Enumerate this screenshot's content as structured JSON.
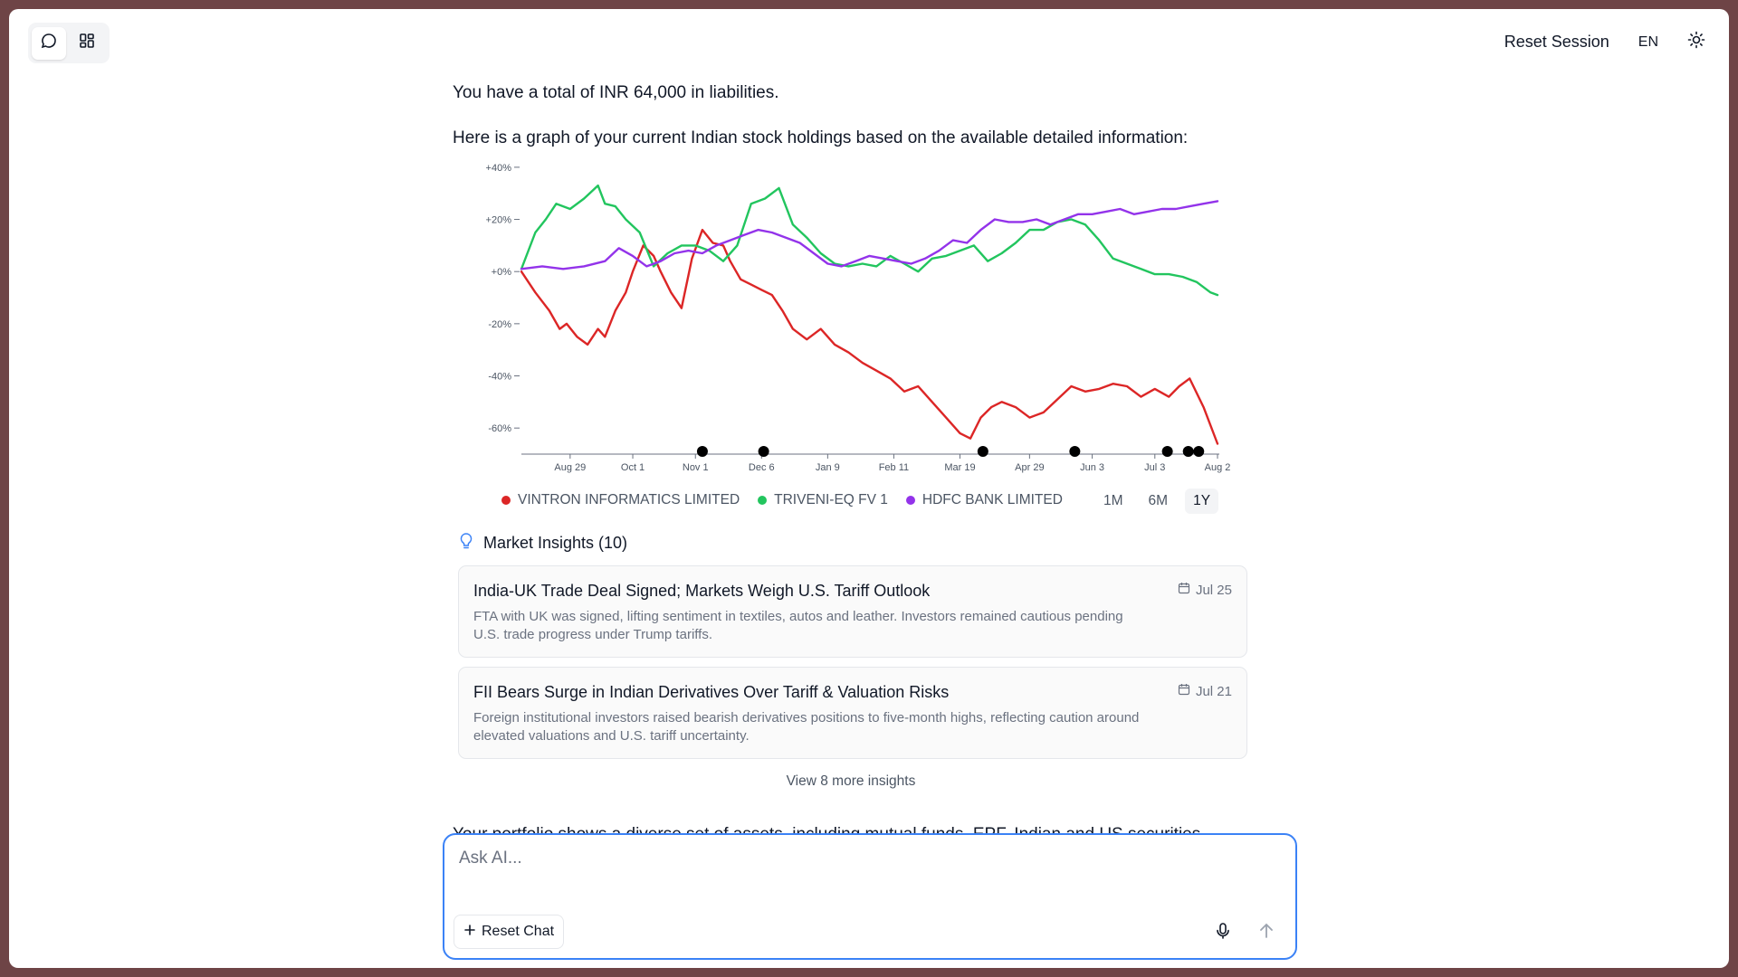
{
  "header": {
    "reset_session": "Reset Session",
    "language": "EN"
  },
  "chat": {
    "liabilities_text": "You have a total of INR 64,000 in liabilities.",
    "graph_intro": "Here is a graph of your current Indian stock holdings based on the available detailed information:",
    "next_text_peek": "Your portfolio shows a diverse set of assets, including mutual funds, EPF, Indian and US securities"
  },
  "chart_data": {
    "type": "line",
    "y_tick_labels": [
      "+40%",
      "+20%",
      "+0%",
      "-20%",
      "-40%",
      "-60%"
    ],
    "y_ticks": [
      40,
      20,
      0,
      -20,
      -40,
      -60
    ],
    "ylim": [
      -70,
      41
    ],
    "x_tick_labels": [
      "Aug 29",
      "Oct 1",
      "Nov 1",
      "Dec 6",
      "Jan 9",
      "Feb 11",
      "Mar 19",
      "Apr 29",
      "Jun 3",
      "Jul 3",
      "Aug 2"
    ],
    "x_tick_positions": [
      0.07,
      0.16,
      0.25,
      0.345,
      0.44,
      0.535,
      0.63,
      0.73,
      0.82,
      0.91,
      1.0
    ],
    "event_markers_x": [
      0.26,
      0.348,
      0.663,
      0.795,
      0.928,
      0.958,
      0.973
    ],
    "series": [
      {
        "name": "VINTRON INFORMATICS LIMITED",
        "color": "#dc2626",
        "x": [
          0,
          0.02,
          0.04,
          0.055,
          0.065,
          0.08,
          0.095,
          0.11,
          0.12,
          0.135,
          0.15,
          0.16,
          0.175,
          0.19,
          0.2,
          0.215,
          0.23,
          0.245,
          0.26,
          0.275,
          0.29,
          0.3,
          0.315,
          0.33,
          0.345,
          0.36,
          0.375,
          0.39,
          0.41,
          0.43,
          0.45,
          0.47,
          0.49,
          0.51,
          0.53,
          0.55,
          0.57,
          0.59,
          0.61,
          0.63,
          0.645,
          0.66,
          0.675,
          0.69,
          0.71,
          0.73,
          0.75,
          0.77,
          0.79,
          0.81,
          0.83,
          0.85,
          0.87,
          0.89,
          0.91,
          0.93,
          0.945,
          0.96,
          0.98,
          1.0
        ],
        "y": [
          0,
          -8,
          -15,
          -22,
          -20,
          -25,
          -28,
          -22,
          -25,
          -15,
          -8,
          0,
          10,
          6,
          0,
          -8,
          -14,
          5,
          16,
          11,
          10,
          4,
          -3,
          -5,
          -7,
          -9,
          -15,
          -22,
          -26,
          -22,
          -28,
          -31,
          -35,
          -38,
          -41,
          -46,
          -44,
          -50,
          -56,
          -62,
          -64,
          -56,
          -52,
          -50,
          -52,
          -56,
          -54,
          -49,
          -44,
          -46,
          -45,
          -43,
          -44,
          -48,
          -45,
          -48,
          -44,
          -41,
          -52,
          -66
        ]
      },
      {
        "name": "TRIVENI-EQ FV 1",
        "color": "#22c55e",
        "x": [
          0,
          0.02,
          0.035,
          0.05,
          0.07,
          0.09,
          0.11,
          0.12,
          0.135,
          0.15,
          0.17,
          0.19,
          0.21,
          0.23,
          0.25,
          0.27,
          0.29,
          0.31,
          0.33,
          0.35,
          0.37,
          0.39,
          0.41,
          0.43,
          0.45,
          0.47,
          0.49,
          0.51,
          0.53,
          0.55,
          0.57,
          0.59,
          0.61,
          0.63,
          0.65,
          0.67,
          0.69,
          0.71,
          0.73,
          0.75,
          0.77,
          0.79,
          0.81,
          0.83,
          0.85,
          0.87,
          0.89,
          0.91,
          0.93,
          0.95,
          0.97,
          0.99,
          1.0
        ],
        "y": [
          1,
          15,
          20,
          26,
          24,
          28,
          33,
          26,
          25,
          20,
          15,
          2,
          7,
          10,
          10,
          8,
          4,
          10,
          26,
          28,
          32,
          18,
          13,
          7,
          3,
          2,
          3,
          2,
          6,
          3,
          0,
          5,
          6,
          8,
          10,
          4,
          7,
          11,
          16,
          16,
          19,
          20,
          18,
          12,
          5,
          3,
          1,
          -1,
          -1,
          -2,
          -4,
          -8,
          -9
        ]
      },
      {
        "name": "HDFC BANK LIMITED",
        "color": "#9333ea",
        "x": [
          0,
          0.03,
          0.06,
          0.09,
          0.12,
          0.14,
          0.16,
          0.18,
          0.2,
          0.22,
          0.24,
          0.26,
          0.28,
          0.3,
          0.32,
          0.34,
          0.36,
          0.38,
          0.4,
          0.42,
          0.44,
          0.46,
          0.48,
          0.5,
          0.52,
          0.54,
          0.56,
          0.58,
          0.6,
          0.62,
          0.64,
          0.66,
          0.68,
          0.7,
          0.72,
          0.74,
          0.76,
          0.78,
          0.8,
          0.82,
          0.84,
          0.86,
          0.88,
          0.9,
          0.92,
          0.94,
          0.96,
          0.98,
          1.0
        ],
        "y": [
          1,
          2,
          1,
          2,
          4,
          9,
          6,
          2,
          4,
          7,
          8,
          7,
          10,
          12,
          14,
          16,
          15,
          13,
          11,
          7,
          3,
          2,
          4,
          6,
          5,
          4,
          3,
          5,
          8,
          12,
          11,
          16,
          20,
          19,
          19,
          20,
          18,
          20,
          22,
          22,
          23,
          24,
          22,
          23,
          24,
          24,
          25,
          26,
          27
        ]
      }
    ],
    "legend": [
      "VINTRON INFORMATICS LIMITED",
      "TRIVENI-EQ FV 1",
      "HDFC BANK LIMITED"
    ],
    "legend_position": "bottom-left",
    "grid": false
  },
  "range_buttons": [
    "1M",
    "6M",
    "1Y"
  ],
  "range_selected": "1Y",
  "insights": {
    "title": "Market Insights (10)",
    "cards": [
      {
        "title": "India-UK Trade Deal Signed; Markets Weigh U.S. Tariff Outlook",
        "date": "Jul 25",
        "desc": "FTA with UK was signed, lifting sentiment in textiles, autos and leather. Investors remained cautious pending U.S. trade progress under Trump tariffs."
      },
      {
        "title": "FII Bears Surge in Indian Derivatives Over Tariff & Valuation Risks",
        "date": "Jul 21",
        "desc": "Foreign institutional investors raised bearish derivatives positions to five-month highs, reflecting caution around elevated valuations and U.S. tariff uncertainty."
      }
    ],
    "view_more": "View 8 more insights"
  },
  "composer": {
    "placeholder": "Ask AI...",
    "reset_chat": "Reset Chat"
  },
  "colors": {
    "accent_blue": "#3b82f6",
    "background_frame": "#6e4446"
  }
}
